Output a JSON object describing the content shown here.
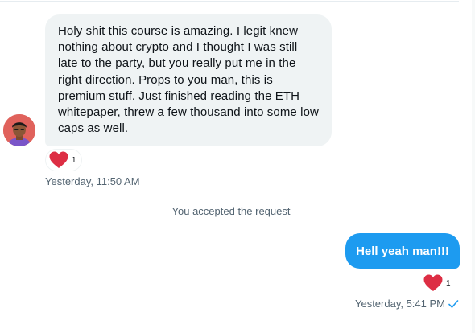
{
  "conversation": {
    "incoming": {
      "lines": [
        "Holy shit this course is amazing. I legit knew",
        "nothing about crypto and I thought I was still",
        "late to the party, but you really put me in the",
        "right direction. Props to you man, this is",
        "premium stuff. Just finished reading the ETH",
        "whitepaper, threw a few thousand into some low",
        "caps as well."
      ],
      "reaction": {
        "icon": "heart-icon",
        "count": "1"
      },
      "timestamp": "Yesterday, 11:50 AM"
    },
    "system_message": "You accepted the request",
    "outgoing": {
      "text": "Hell yeah man!!!",
      "reaction": {
        "icon": "heart-icon",
        "count": "1"
      },
      "timestamp": "Yesterday, 5:41 PM",
      "status_icon": "check-icon"
    }
  },
  "colors": {
    "incoming_bubble": "#eff3f4",
    "outgoing_bubble": "#1d9bf0",
    "heart": "#f91880",
    "muted_text": "#536471",
    "check": "#1d9bf0"
  }
}
